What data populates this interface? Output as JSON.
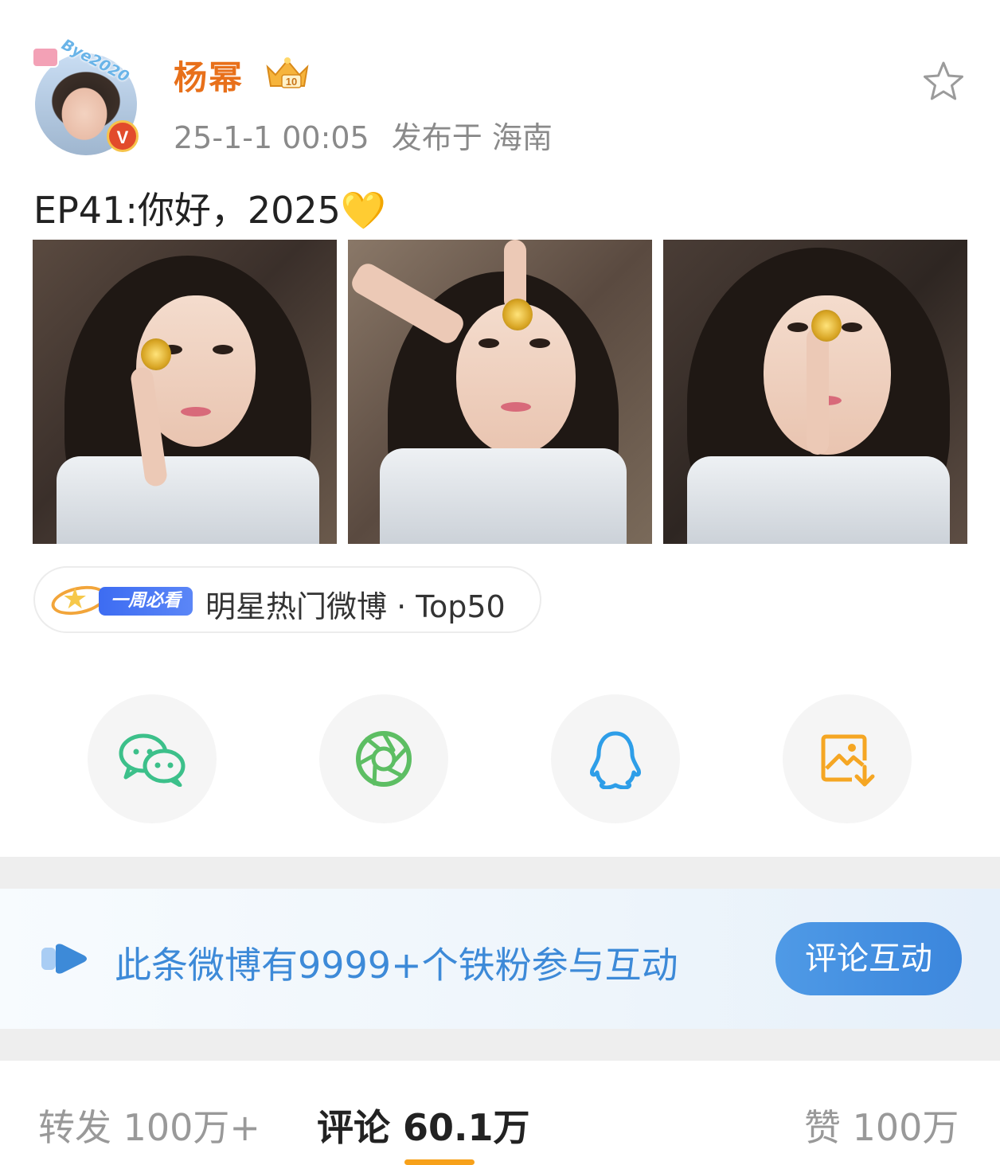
{
  "author": {
    "name": "杨幂",
    "avatar_frame_text": "Bye2020",
    "verified_badge": "V",
    "timestamp": "25-1-1 00:05",
    "location": "发布于 海南"
  },
  "post": {
    "text": "EP41:你好，2025💛",
    "image_count": 3
  },
  "tag": {
    "badge_label": "一周必看",
    "text": "明星热门微博 · Top50"
  },
  "share": {
    "items": [
      "wechat-icon",
      "moments-icon",
      "qq-icon",
      "save-image-icon"
    ],
    "colors": {
      "wechat": "#3cc08a",
      "moments": "#5dbe63",
      "qq": "#2e9ee8",
      "save": "#f5a623"
    }
  },
  "fans": {
    "text": "此条微博有9999+个铁粉参与互动",
    "button_label": "评论互动"
  },
  "stats": {
    "repost_label": "转发",
    "repost_count": "100万+",
    "comment_label": "评论",
    "comment_count": "60.1万",
    "like_label": "赞",
    "like_count": "100万"
  },
  "colors": {
    "username": "#e8701a",
    "accent_blue": "#3d8ad8",
    "underline": "#f7a11a"
  }
}
